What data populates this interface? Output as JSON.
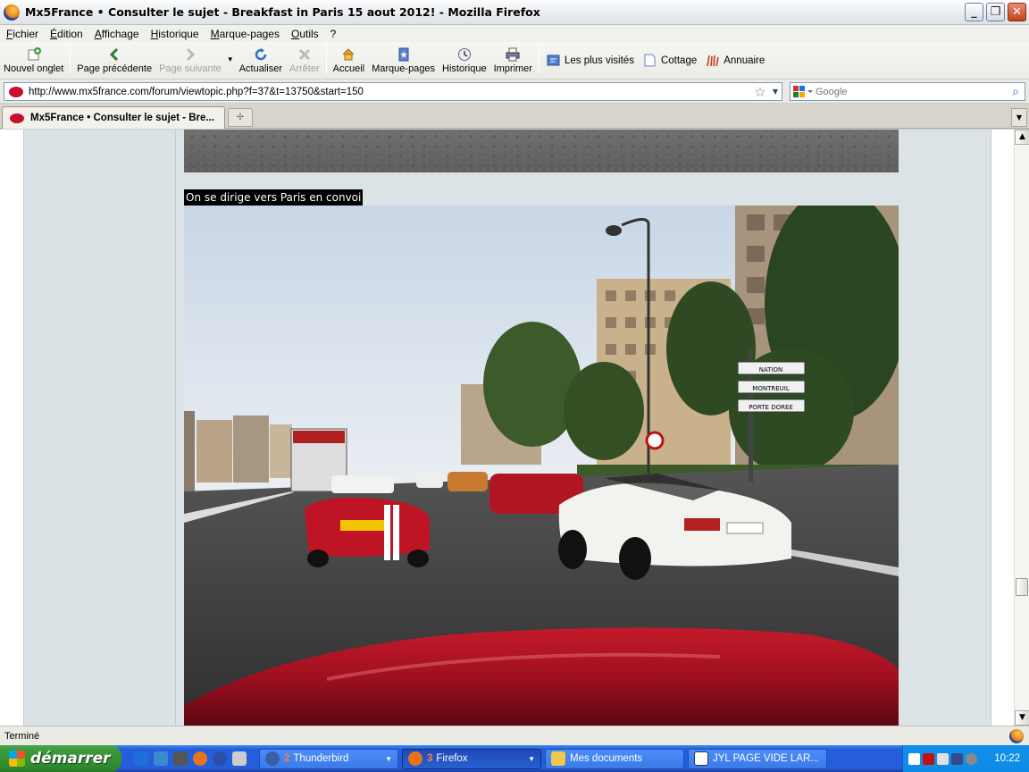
{
  "window": {
    "title": "Mx5France • Consulter le sujet - Breakfast in Paris 15 aout 2012! - Mozilla Firefox",
    "minimize": "_",
    "restore": "❐",
    "close": "✕"
  },
  "menu": [
    "Fichier",
    "Édition",
    "Affichage",
    "Historique",
    "Marque-pages",
    "Outils",
    "?"
  ],
  "toolbar": {
    "new_tab": "Nouvel onglet",
    "back": "Page précédente",
    "forward": "Page suivante",
    "reload": "Actualiser",
    "stop": "Arrêter",
    "home": "Accueil",
    "bookmarks": "Marque-pages",
    "history": "Historique",
    "print": "Imprimer"
  },
  "bookmarks_bar": [
    "Les plus visités",
    "Cottage",
    "Annuaire"
  ],
  "address": {
    "url": "http://www.mx5france.com/forum/viewtopic.php?f=37&t=13750&start=150"
  },
  "search": {
    "placeholder": "Google"
  },
  "tab": {
    "title": "Mx5France • Consulter le sujet - Bre..."
  },
  "post": {
    "caption": "On se dirige vers Paris en convoi"
  },
  "photo_signs": [
    "NATION",
    "MONTREUIL",
    "PORTE DOREE"
  ],
  "status": {
    "text": "Terminé"
  },
  "taskbar": {
    "start": "démarrer",
    "tasks": [
      {
        "count": "2",
        "label": "Thunderbird"
      },
      {
        "count": "3",
        "label": "Firefox"
      },
      {
        "count": "",
        "label": "Mes documents"
      },
      {
        "count": "",
        "label": "JYL    PAGE VIDE LAR..."
      }
    ],
    "clock": "10:22"
  },
  "colors": {
    "page_bg": "#dce3e7",
    "xp_blue": "#245edb",
    "start_green": "#3c9a3c",
    "caption_bg": "#000000"
  }
}
